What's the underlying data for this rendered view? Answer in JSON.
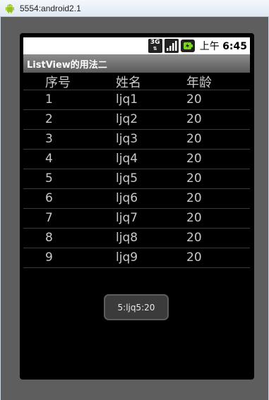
{
  "window": {
    "title": "5554:android2.1",
    "icon": "android-icon"
  },
  "statusbar": {
    "network_label": "3G",
    "time_prefix": "上午",
    "time": "6:45"
  },
  "app": {
    "title": "ListView的用法二"
  },
  "list": {
    "headers": [
      "序号",
      "姓名",
      "年龄"
    ],
    "rows": [
      [
        "1",
        "ljq1",
        "20"
      ],
      [
        "2",
        "ljq2",
        "20"
      ],
      [
        "3",
        "ljq3",
        "20"
      ],
      [
        "4",
        "ljq4",
        "20"
      ],
      [
        "5",
        "ljq5",
        "20"
      ],
      [
        "6",
        "ljq6",
        "20"
      ],
      [
        "7",
        "ljq7",
        "20"
      ],
      [
        "8",
        "ljq8",
        "20"
      ],
      [
        "9",
        "ljq9",
        "20"
      ]
    ]
  },
  "toast": {
    "text": "5:ljq5:20"
  }
}
